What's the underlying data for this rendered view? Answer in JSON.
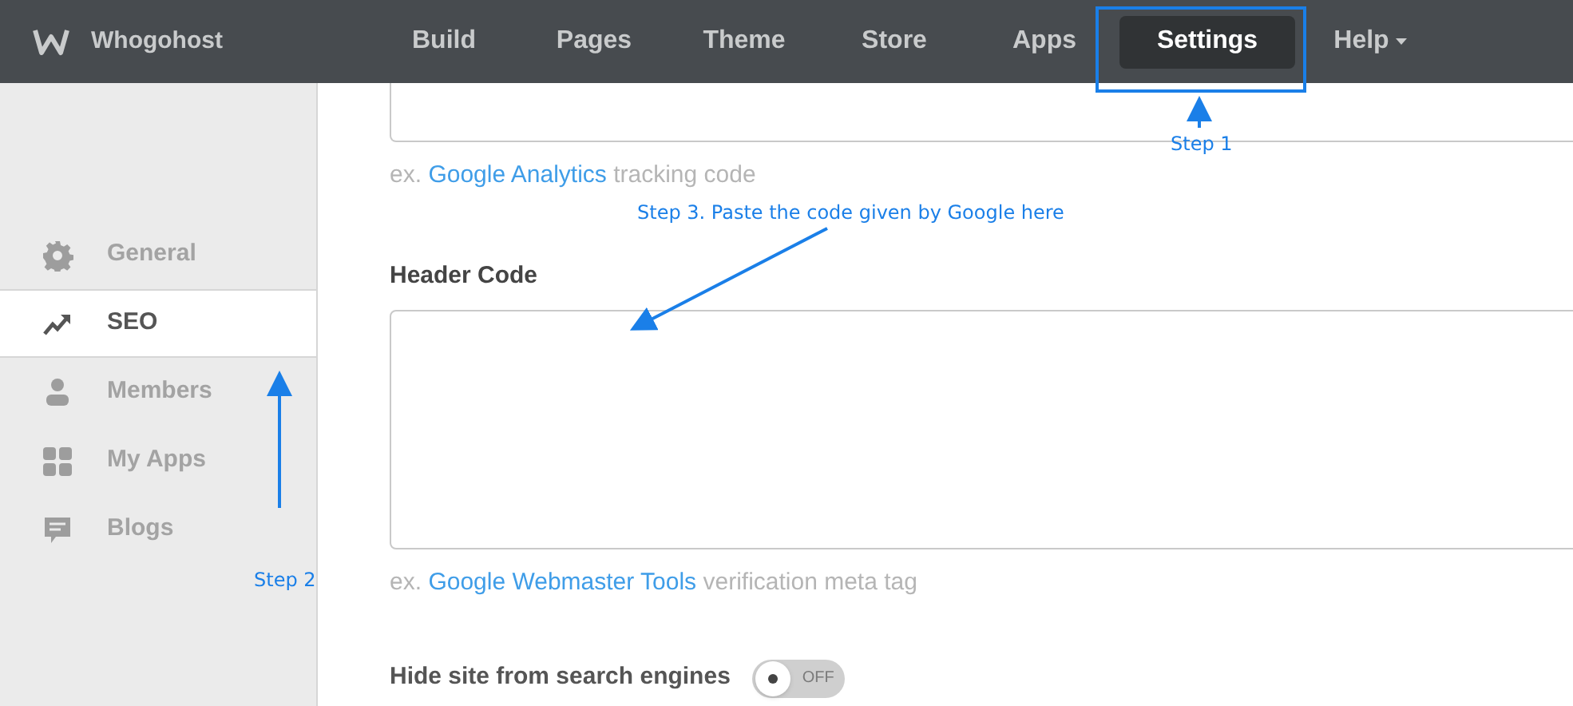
{
  "brand": {
    "name": "Whogohost"
  },
  "nav": [
    {
      "label": "Build",
      "selected": false
    },
    {
      "label": "Pages",
      "selected": false
    },
    {
      "label": "Theme",
      "selected": false
    },
    {
      "label": "Store",
      "selected": false
    },
    {
      "label": "Apps",
      "selected": false
    },
    {
      "label": "Settings",
      "selected": true
    },
    {
      "label": "Help",
      "selected": false,
      "kind": "dropdown"
    }
  ],
  "sidebar": {
    "items": [
      {
        "label": "General",
        "selected": false
      },
      {
        "label": "SEO",
        "selected": true
      },
      {
        "label": "Members",
        "selected": false
      },
      {
        "label": "My Apps",
        "selected": false
      },
      {
        "label": "Blogs",
        "selected": false
      }
    ]
  },
  "footer_hint": {
    "prefix": "ex.",
    "link": "Google Analytics",
    "suffix": "tracking code"
  },
  "header_code": {
    "label": "Header Code",
    "hint": {
      "prefix": "ex.",
      "link": "Google Webmaster Tools",
      "suffix": "verification meta tag"
    }
  },
  "hide_site": {
    "label": "Hide site from search engines",
    "on": false,
    "state_text": "OFF"
  },
  "annotations": [
    {
      "text": "Step 1"
    },
    {
      "text": "Step 2"
    },
    {
      "text": "Step 3. Paste the code given by Google here"
    }
  ]
}
